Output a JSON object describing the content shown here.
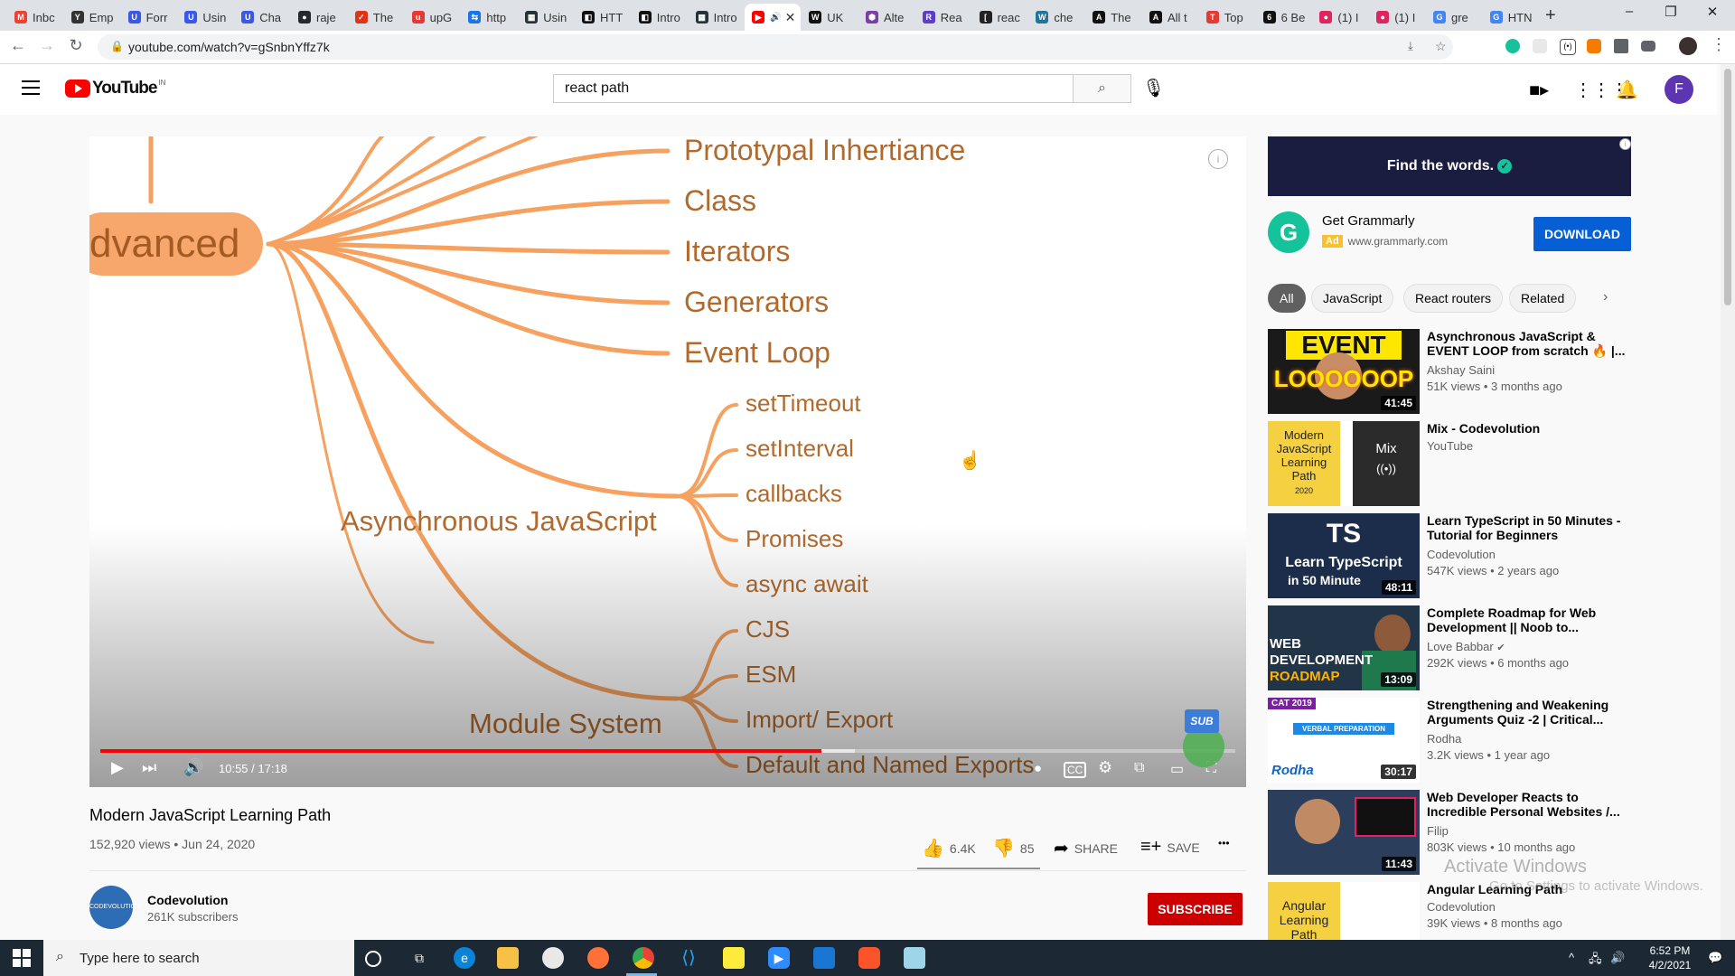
{
  "browser": {
    "tabs": [
      {
        "label": "Inbc",
        "color": "#ea4335",
        "glyph": "M"
      },
      {
        "label": "Emp",
        "color": "#333333",
        "glyph": "Y"
      },
      {
        "label": "Forr",
        "color": "#3a57e8",
        "glyph": "U"
      },
      {
        "label": "Usin",
        "color": "#3a57e8",
        "glyph": "U"
      },
      {
        "label": "Cha",
        "color": "#3a57e8",
        "glyph": "U"
      },
      {
        "label": "raje",
        "color": "#24292e",
        "glyph": "●"
      },
      {
        "label": "The",
        "color": "#e0341a",
        "glyph": "✓"
      },
      {
        "label": "upG",
        "color": "#e53935",
        "glyph": "u"
      },
      {
        "label": "http",
        "color": "#1a73e8",
        "glyph": "⇆"
      },
      {
        "label": "Usin",
        "color": "#263238",
        "glyph": "▦"
      },
      {
        "label": "HTT",
        "color": "#111111",
        "glyph": "◧"
      },
      {
        "label": "Intro",
        "color": "#111111",
        "glyph": "◧"
      },
      {
        "label": "Intro",
        "color": "#263238",
        "glyph": "▦"
      },
      {
        "label": "",
        "color": "#ff0000",
        "glyph": "▶"
      },
      {
        "label": "UK",
        "color": "#111111",
        "glyph": "W"
      },
      {
        "label": "Alte",
        "color": "#7b3fa0",
        "glyph": "⬢"
      },
      {
        "label": "Rea",
        "color": "#5c3ec2",
        "glyph": "R"
      },
      {
        "label": "reac",
        "color": "#222222",
        "glyph": "["
      },
      {
        "label": "che",
        "color": "#21759b",
        "glyph": "W"
      },
      {
        "label": "The",
        "color": "#111111",
        "glyph": "A"
      },
      {
        "label": "All t",
        "color": "#111111",
        "glyph": "A"
      },
      {
        "label": "Top",
        "color": "#e53935",
        "glyph": "T"
      },
      {
        "label": "6 Be",
        "color": "#111111",
        "glyph": "6"
      },
      {
        "label": "(1) I",
        "color": "#e0245e",
        "glyph": "●"
      },
      {
        "label": "(1) I",
        "color": "#e0245e",
        "glyph": "●"
      },
      {
        "label": "gre",
        "color": "#4285f4",
        "glyph": "G"
      },
      {
        "label": "HTN",
        "color": "#4285f4",
        "glyph": "G"
      }
    ],
    "new_tab": "+",
    "url": "youtube.com/watch?v=gSnbnYffz7k",
    "window_controls": [
      "–",
      "❐",
      "✕"
    ]
  },
  "header": {
    "logo_text": "YouTube",
    "region": "IN",
    "search_value": "react path",
    "avatar_letter": "F"
  },
  "player": {
    "mindmap": {
      "root_fragment": "dvanced",
      "top_items": [
        "Prototypal Inhertiance",
        "Class",
        "Iterators",
        "Generators",
        "Event Loop"
      ],
      "async_label": "Asynchronous JavaScript",
      "async_items": [
        "setTimeout",
        "setInterval",
        "callbacks",
        "Promises",
        "async await"
      ],
      "module_label": "Module System",
      "module_items": [
        "CJS",
        "ESM",
        "Import/ Export",
        "Default and Named Exports"
      ]
    },
    "time_display": "10:55 / 17:18",
    "progress_fraction": 0.635,
    "buffer_fraction": 0.665,
    "sub_badge": "SUB",
    "info_glyph": "i"
  },
  "video": {
    "title": "Modern JavaScript Learning Path",
    "meta": "152,920 views • Jun 24, 2020",
    "likes": "6.4K",
    "dislikes": "85",
    "share": "SHARE",
    "save": "SAVE",
    "more": "•••"
  },
  "channel": {
    "name": "Codevolution",
    "subscribers": "261K subscribers",
    "avatar_text": "CODEVOLUTION",
    "subscribe": "SUBSCRIBE"
  },
  "ad": {
    "banner": "Find the words.",
    "logo": "G",
    "name": "Get Grammarly",
    "badge": "Ad",
    "domain": "www.grammarly.com",
    "cta": "DOWNLOAD"
  },
  "chips": [
    "All",
    "JavaScript",
    "React routers",
    "Related"
  ],
  "recommendations": [
    {
      "title": "Asynchronous JavaScript & EVENT LOOP from scratch 🔥 |...",
      "channel": "Akshay Saini",
      "meta": "51K views • 3 months ago",
      "duration": "41:45",
      "thumb_top": "EVENT",
      "thumb_bottom": "LOOOOOOP"
    },
    {
      "title": "Mix - Codevolution",
      "channel": "YouTube",
      "meta": "",
      "duration": "",
      "thumb_left": "Modern JavaScript Learning Path",
      "thumb_year": "2020",
      "thumb_mix": "Mix",
      "thumb_mix_icon": "((•))"
    },
    {
      "title": "Learn TypeScript in 50 Minutes - Tutorial for Beginners",
      "channel": "Codevolution",
      "meta": "547K views • 2 years ago",
      "duration": "48:11",
      "thumb_top": "TS",
      "thumb_bottom": "Learn TypeScript",
      "thumb_small": "in 50 Minute"
    },
    {
      "title": "Complete Roadmap for Web Development || Noob to...",
      "channel": "Love Babbar",
      "meta": "292K views • 6 months ago",
      "duration": "13:09",
      "thumb_top": "WEB",
      "thumb_bottom": "DEVELOPMENT",
      "thumb_small": "ROADMAP"
    },
    {
      "title": "Strengthening and Weakening Arguments Quiz -2 | Critical...",
      "channel": "Rodha",
      "meta": "3.2K views • 1 year ago",
      "duration": "30:17",
      "thumb_top": "CAT 2019",
      "thumb_bottom": "VERBAL PREPARATION",
      "thumb_small": "Rodha"
    },
    {
      "title": "Web Developer Reacts to Incredible Personal Websites /...",
      "channel": "Filip",
      "meta": "803K views • 10 months ago",
      "duration": "11:43"
    },
    {
      "title": "Angular Learning Path",
      "channel": "Codevolution",
      "meta": "39K views • 8 months ago",
      "duration": "",
      "thumb_left": "Angular Learning Path"
    }
  ],
  "watermark": {
    "line1": "Activate Windows",
    "line2": "Go to Settings to activate Windows."
  },
  "taskbar": {
    "search_placeholder": "Type here to search",
    "time": "6:52 PM",
    "date": "4/2/2021"
  },
  "colors": {
    "youtube_red": "#ff0000",
    "subscribe_red": "#cc0000",
    "mindmap_branch": "#f6a15f",
    "mindmap_text": "#b06a2e",
    "download_blue": "#065fd4",
    "grammarly_green": "#15c39a"
  }
}
